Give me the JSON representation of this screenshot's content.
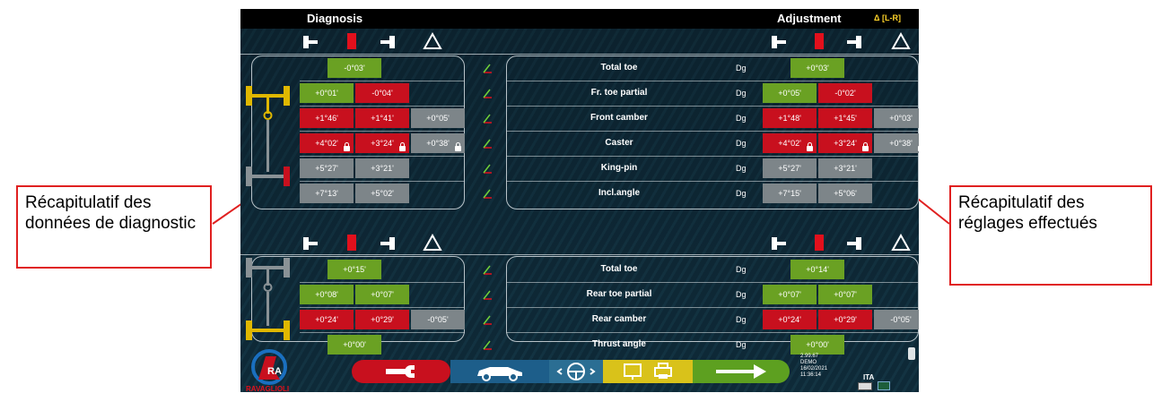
{
  "header": {
    "diagnosis": "Diagnosis",
    "adjustment": "Adjustment",
    "delta": "Δ [L-R]"
  },
  "front_rows": [
    {
      "label": "Total toe",
      "unit": "Dg",
      "diag": [
        {
          "v": "-0°03'",
          "c": "g"
        }
      ],
      "adj": [
        {
          "v": "+0°03'",
          "c": "g"
        }
      ]
    },
    {
      "label": "Fr. toe partial",
      "unit": "Dg",
      "diag": [
        {
          "v": "+0°01'",
          "c": "g"
        },
        {
          "v": "-0°04'",
          "c": "r"
        }
      ],
      "adj": [
        {
          "v": "+0°05'",
          "c": "g"
        },
        {
          "v": "-0°02'",
          "c": "r"
        }
      ]
    },
    {
      "label": "Front camber",
      "unit": "Dg",
      "diag": [
        {
          "v": "+1°46'",
          "c": "r"
        },
        {
          "v": "+1°41'",
          "c": "r"
        },
        {
          "v": "+0°05'",
          "c": "s"
        }
      ],
      "adj": [
        {
          "v": "+1°48'",
          "c": "r"
        },
        {
          "v": "+1°45'",
          "c": "r"
        },
        {
          "v": "+0°03'",
          "c": "s"
        }
      ]
    },
    {
      "label": "Caster",
      "unit": "Dg",
      "diag": [
        {
          "v": "+4°02'",
          "c": "r",
          "lock": true
        },
        {
          "v": "+3°24'",
          "c": "r",
          "lock": true
        },
        {
          "v": "+0°38'",
          "c": "s",
          "lock": true
        }
      ],
      "adj": [
        {
          "v": "+4°02'",
          "c": "r",
          "lock": true
        },
        {
          "v": "+3°24'",
          "c": "r",
          "lock": true
        },
        {
          "v": "+0°38'",
          "c": "s",
          "lock": true
        }
      ]
    },
    {
      "label": "King-pin",
      "unit": "Dg",
      "diag": [
        {
          "v": "+5°27'",
          "c": "s"
        },
        {
          "v": "+3°21'",
          "c": "s"
        }
      ],
      "adj": [
        {
          "v": "+5°27'",
          "c": "s"
        },
        {
          "v": "+3°21'",
          "c": "s"
        }
      ]
    },
    {
      "label": "Incl.angle",
      "unit": "Dg",
      "diag": [
        {
          "v": "+7°13'",
          "c": "s"
        },
        {
          "v": "+5°02'",
          "c": "s"
        }
      ],
      "adj": [
        {
          "v": "+7°15'",
          "c": "s"
        },
        {
          "v": "+5°06'",
          "c": "s"
        }
      ]
    }
  ],
  "rear_rows": [
    {
      "label": "Total toe",
      "unit": "Dg",
      "diag": [
        {
          "v": "+0°15'",
          "c": "g"
        }
      ],
      "adj": [
        {
          "v": "+0°14'",
          "c": "g"
        }
      ]
    },
    {
      "label": "Rear toe partial",
      "unit": "Dg",
      "diag": [
        {
          "v": "+0°08'",
          "c": "g"
        },
        {
          "v": "+0°07'",
          "c": "g"
        }
      ],
      "adj": [
        {
          "v": "+0°07'",
          "c": "g"
        },
        {
          "v": "+0°07'",
          "c": "g"
        }
      ]
    },
    {
      "label": "Rear camber",
      "unit": "Dg",
      "diag": [
        {
          "v": "+0°24'",
          "c": "r"
        },
        {
          "v": "+0°29'",
          "c": "r"
        },
        {
          "v": "-0°05'",
          "c": "s"
        }
      ],
      "adj": [
        {
          "v": "+0°24'",
          "c": "r"
        },
        {
          "v": "+0°29'",
          "c": "r"
        },
        {
          "v": "-0°05'",
          "c": "s"
        }
      ]
    },
    {
      "label": "Thrust angle",
      "unit": "Dg",
      "diag": [
        {
          "v": "+0°00'",
          "c": "g"
        }
      ],
      "adj": [
        {
          "v": "+0°00'",
          "c": "g"
        }
      ]
    }
  ],
  "status": {
    "version": "2.99.67",
    "mode": "DEMO",
    "date": "16/02/2021",
    "time": "11:36:14",
    "lang": "ITA"
  },
  "logo_text": "RAVAGLIOLI",
  "notes": {
    "left": "Récapitulatif des données de diagnostic",
    "right": "Récapitulatif des réglages effectués"
  },
  "colors": {
    "green": "#6aa123",
    "red": "#c8101e",
    "gray": "#7d8589",
    "annotation": "#e02020"
  }
}
